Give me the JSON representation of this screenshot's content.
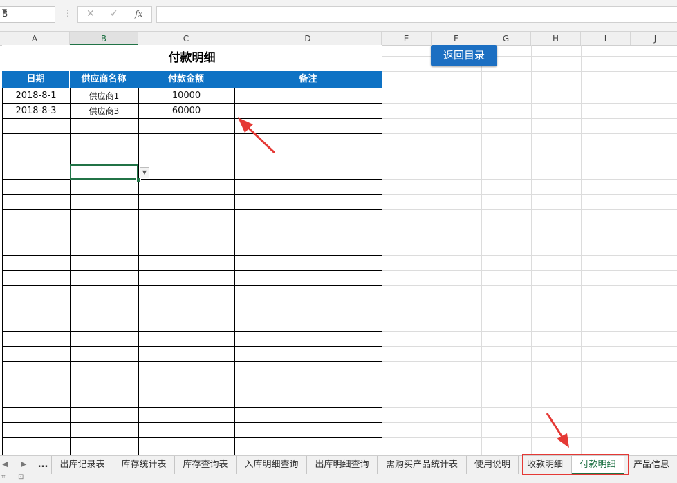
{
  "formula_bar": {
    "name_box": "B",
    "cancel_icon": "✕",
    "confirm_icon": "✓",
    "fx_label": "fx",
    "formula_value": ""
  },
  "columns": [
    "A",
    "B",
    "C",
    "D",
    "E",
    "F",
    "G",
    "H",
    "I",
    "J"
  ],
  "sheet": {
    "title": "付款明细",
    "headers": [
      "日期",
      "供应商名称",
      "付款金额",
      "备注"
    ],
    "rows": [
      {
        "date": "2018-8-1",
        "supplier": "供应商1",
        "amount": "10000",
        "note": ""
      },
      {
        "date": "2018-8-3",
        "supplier": "供应商3",
        "amount": "60000",
        "note": ""
      }
    ],
    "return_button": "返回目录"
  },
  "tabs": {
    "ellipsis": "...",
    "items": [
      "出库记录表",
      "库存统计表",
      "库存查询表",
      "入库明细查询",
      "出库明细查询",
      "需购买产品统计表",
      "使用说明",
      "收款明细",
      "付款明细",
      "产品信息"
    ],
    "active": "付款明细"
  },
  "colors": {
    "header_blue": "#0e72c4",
    "button_blue": "#1c6fc2",
    "excel_green": "#217346",
    "annotation_red": "#e53935"
  }
}
